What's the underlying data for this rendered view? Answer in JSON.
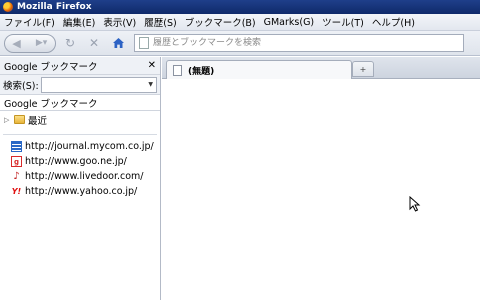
{
  "window": {
    "title": "Mozilla Firefox"
  },
  "menu": [
    "ファイル(F)",
    "編集(E)",
    "表示(V)",
    "履歴(S)",
    "ブックマーク(B)",
    "GMarks(G)",
    "ツール(T)",
    "ヘルプ(H)"
  ],
  "toolbar": {
    "back_icon": "back-arrow-icon",
    "forward_icon": "forward-arrow-icon",
    "reload_icon": "reload-icon",
    "stop_icon": "stop-icon",
    "home_icon": "home-icon",
    "url_placeholder": "履歴とブックマークを検索"
  },
  "sidebar": {
    "title": "Google ブックマーク",
    "search_label": "検索(S):",
    "search_value": "",
    "root_label": "Google ブックマーク",
    "folders": [
      {
        "label": "最近"
      }
    ],
    "links": [
      {
        "url": "http://journal.mycom.co.jp/",
        "icon": "journal-favicon"
      },
      {
        "url": "http://www.goo.ne.jp/",
        "icon": "goo-favicon"
      },
      {
        "url": "http://www.livedoor.com/",
        "icon": "livedoor-favicon"
      },
      {
        "url": "http://www.yahoo.co.jp/",
        "icon": "yahoo-favicon"
      }
    ]
  },
  "tabs": [
    {
      "label": "(無題)"
    }
  ],
  "colors": {
    "titlebar": "#1f3f8a",
    "home_icon": "#2c62c4",
    "folder": "#e8b43a"
  }
}
